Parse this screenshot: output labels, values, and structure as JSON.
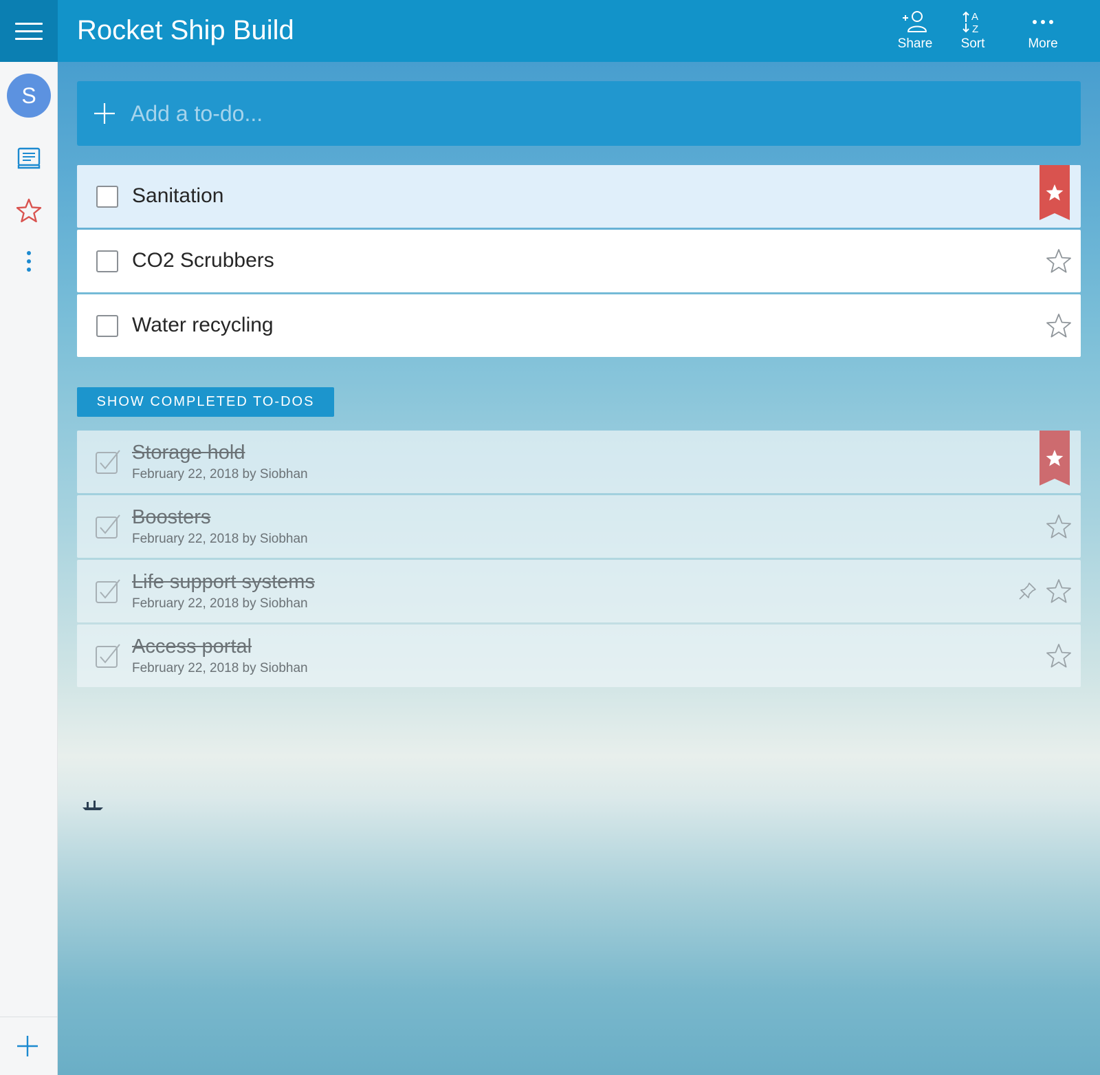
{
  "header": {
    "title": "Rocket Ship Build",
    "share_label": "Share",
    "sort_label": "Sort",
    "more_label": "More",
    "sort_icon_letters": [
      "A",
      "Z"
    ]
  },
  "sidebar": {
    "avatar_initial": "S",
    "icons": [
      "hamburger-menu-icon",
      "inbox-icon",
      "star-icon",
      "more-vertical-icon",
      "add-list-icon"
    ]
  },
  "add_todo": {
    "placeholder": "Add a to-do..."
  },
  "tasks": [
    {
      "title": "Sanitation",
      "starred": true,
      "selected": true
    },
    {
      "title": "CO2 Scrubbers",
      "starred": false,
      "selected": false
    },
    {
      "title": "Water recycling",
      "starred": false,
      "selected": false
    }
  ],
  "show_completed_label": "SHOW COMPLETED TO-DOS",
  "completed": [
    {
      "title": "Storage hold",
      "meta": "February 22, 2018 by Siobhan",
      "starred": true
    },
    {
      "title": "Boosters",
      "meta": "February 22, 2018 by Siobhan",
      "starred": false
    },
    {
      "title": "Life support systems",
      "meta": "February 22, 2018 by Siobhan",
      "starred": false,
      "pin_visible": true
    },
    {
      "title": "Access portal",
      "meta": "February 22, 2018 by Siobhan",
      "starred": false
    }
  ],
  "colors": {
    "header_blue": "#1293c9",
    "rail_menu_blue": "#0b7fb2",
    "star_red": "#d9534f",
    "avatar_blue": "#5c92e0"
  }
}
